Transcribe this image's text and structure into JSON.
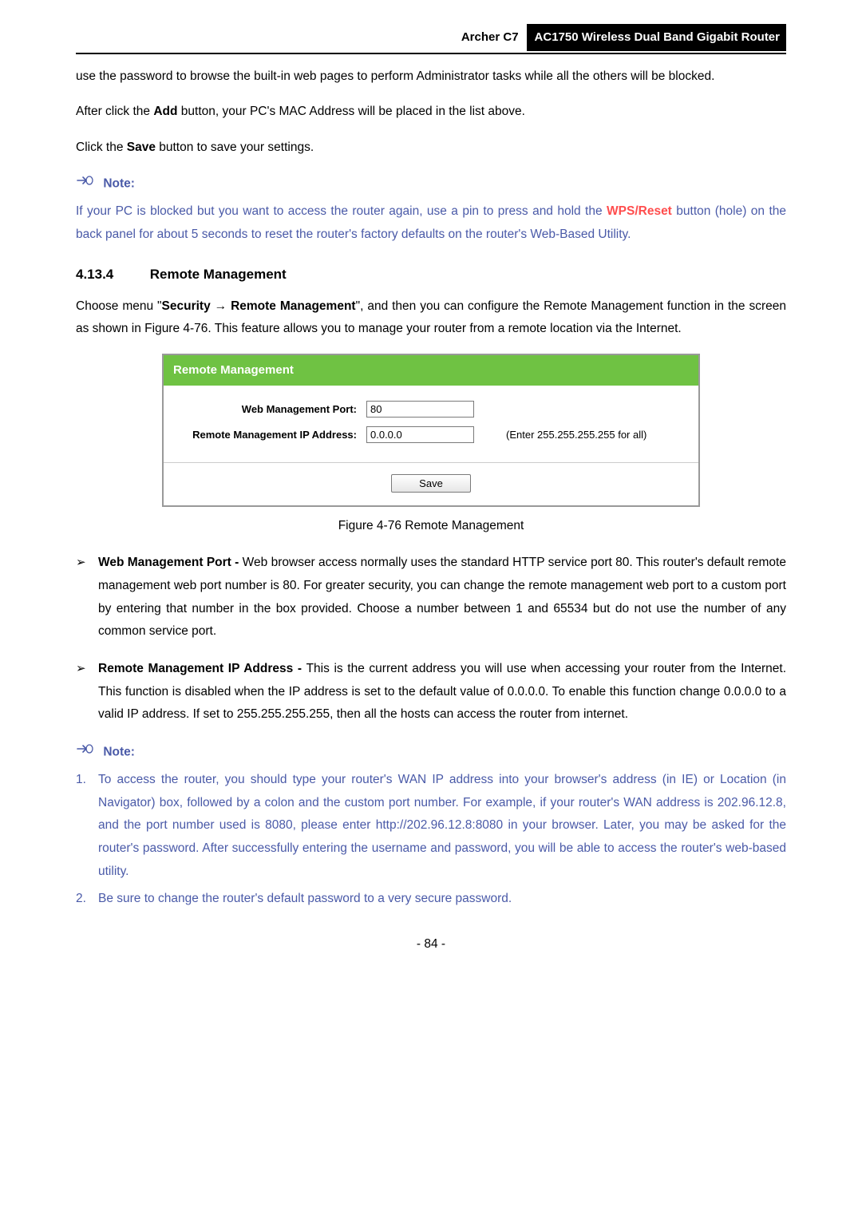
{
  "header": {
    "model": "Archer C7",
    "title": "AC1750 Wireless Dual Band Gigabit Router"
  },
  "intro": {
    "p1": "use the password to browse the built-in web pages to perform Administrator tasks while all the others will be blocked.",
    "p2a": "After click the ",
    "p2b_bold": "Add",
    "p2c": " button, your PC's MAC Address will be placed in the list above.",
    "p3a": "Click the ",
    "p3b_bold": "Save",
    "p3c": " button to save your settings."
  },
  "note1": {
    "label": "Note:",
    "text_a": "If your PC is blocked but you want to access the router again, use a pin to press and hold the ",
    "wps_bold": "WPS/Reset",
    "text_b": " button (hole) on the back panel for about 5 seconds to reset the router's factory defaults on the router's Web-Based Utility."
  },
  "section": {
    "num": "4.13.4",
    "title": "Remote Management",
    "p_a": "Choose menu \"",
    "p_sec": "Security",
    "p_arrow": " → ",
    "p_rm": "Remote Management",
    "p_b": "\", and then you can configure the Remote Management function in the screen as shown in Figure 4-76. This feature allows you to manage your router from a remote location via the Internet."
  },
  "figure": {
    "title": "Remote Management",
    "row1_label": "Web Management Port:",
    "row1_value": "80",
    "row2_label": "Remote Management IP Address:",
    "row2_value": "0.0.0.0",
    "row2_hint": "(Enter 255.255.255.255 for all)",
    "save_label": "Save",
    "caption": "Figure 4-76 Remote Management"
  },
  "bullets": {
    "b1_title": "Web Management Port - ",
    "b1_text": "Web browser access normally uses the standard HTTP service port 80. This router's default remote management web port number is 80. For greater security, you can change the remote management web port to a custom port by entering that number in the box provided. Choose a number between 1 and 65534 but do not use the number of any common service port.",
    "b2_title": "Remote Management IP Address - ",
    "b2_text": "This is the current address you will use when accessing your router from the Internet. This function is disabled when the IP address is set to the default value of 0.0.0.0. To enable this function change 0.0.0.0 to a valid IP address. If set to 255.255.255.255, then all the hosts can access the router from internet."
  },
  "note2": {
    "label": "Note:",
    "n1": "To access the router, you should type your router's WAN IP address into your browser's address (in IE) or Location (in Navigator) box, followed by a colon and the custom port number. For example, if your router's WAN address is 202.96.12.8, and the port number used is 8080, please enter http://202.96.12.8:8080 in your browser. Later, you may be asked for the router's password. After successfully entering the username and password, you will be able to access the router's web-based utility.",
    "n2": "Be sure to change the router's default password to a very secure password."
  },
  "page_number": "- 84 -"
}
